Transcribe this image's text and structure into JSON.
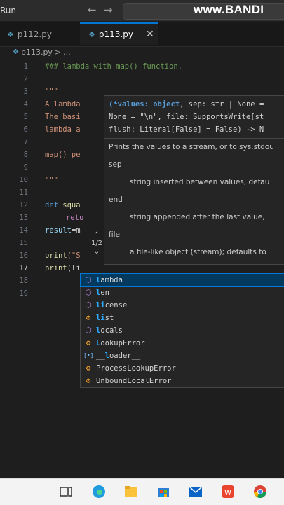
{
  "titlebar": {
    "run_menu": "Run",
    "watermark": "www.BANDI"
  },
  "tabs": [
    {
      "label": "p112.py",
      "active": false
    },
    {
      "label": "p113.py",
      "active": true
    }
  ],
  "breadcrumb": {
    "file": "p113.py",
    "separator": ">",
    "rest": "..."
  },
  "editor": {
    "lines": [
      {
        "n": "1",
        "text": "### lambda with map() function."
      },
      {
        "n": "2",
        "text": ""
      },
      {
        "n": "3",
        "text": "\"\"\""
      },
      {
        "n": "4",
        "text": "A lambda"
      },
      {
        "n": "5",
        "text": "The basi"
      },
      {
        "n": "6",
        "text": "lambda a"
      },
      {
        "n": "7",
        "text": ""
      },
      {
        "n": "8",
        "text": "map() pe"
      },
      {
        "n": "9",
        "text": ""
      },
      {
        "n": "10",
        "text": "\"\"\""
      },
      {
        "n": "11",
        "text": ""
      },
      {
        "n": "12",
        "text_kw": "def",
        "text_rest": " squa"
      },
      {
        "n": "13",
        "text_kw": "retu",
        "text_rest": ""
      },
      {
        "n": "14",
        "text_ident": "result",
        "text_rest": "=m"
      },
      {
        "n": "15",
        "text": ""
      },
      {
        "n": "16",
        "text_func": "print",
        "text_rest": "(\"S"
      },
      {
        "n": "17",
        "text_func": "print",
        "text_rest": "(li"
      },
      {
        "n": "18",
        "text": ""
      },
      {
        "n": "19",
        "text": ""
      }
    ]
  },
  "hover": {
    "sig1": "(*values: object, sep: str | None =",
    "sig2": "None = \"\\n\", file: SupportsWrite[st",
    "sig3": "flush: Literal[False] = False) -> N",
    "doc_intro": "Prints the values to a stream, or to sys.stdou",
    "param1": "sep",
    "param1_desc": "string inserted between values, defau",
    "param2": "end",
    "param2_desc": "string appended after the last value,",
    "param3": "file",
    "param3_desc": "a file-like object (stream); defaults to",
    "overload_counter": "1/2"
  },
  "suggestions": [
    {
      "pre": "",
      "match": "l",
      "post": "ambda",
      "icon": "cube",
      "selected": true
    },
    {
      "pre": "",
      "match": "l",
      "post": "en",
      "icon": "cube",
      "selected": false
    },
    {
      "pre": "",
      "match": "li",
      "post": "cense",
      "icon": "cube",
      "selected": false
    },
    {
      "pre": "",
      "match": "li",
      "post": "st",
      "icon": "class",
      "selected": false
    },
    {
      "pre": "",
      "match": "l",
      "post": "ocals",
      "icon": "cube",
      "selected": false
    },
    {
      "pre": "",
      "match": "L",
      "post": "ookupError",
      "icon": "class",
      "selected": false
    },
    {
      "pre": "__",
      "match": "l",
      "post": "oader__",
      "icon": "var",
      "selected": false
    },
    {
      "pre": "ProcessLookupError",
      "match": "",
      "post": "",
      "icon": "class",
      "selected": false
    },
    {
      "pre": "UnboundLocalError",
      "match": "",
      "post": "",
      "icon": "class",
      "selected": false
    }
  ],
  "colors": {
    "accent": "#0078d4",
    "editor_bg": "#1e1e1e",
    "selection": "#04395e"
  }
}
